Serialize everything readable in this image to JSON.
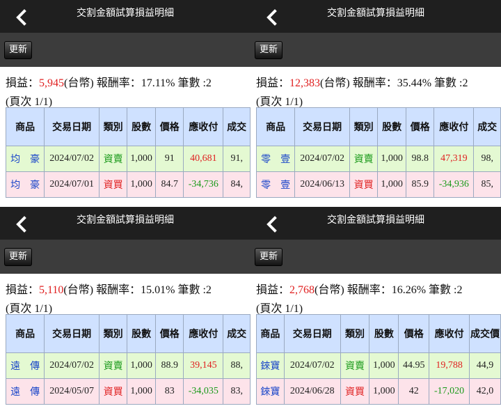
{
  "panels": [
    {
      "title": "交割金額試算損益明細",
      "refresh_label": "更新",
      "summary": {
        "label": "損益：",
        "amount": "5,945",
        "currency": "(台幣)",
        "rate_label": " 報酬率：17.11%",
        "count_label": " 筆數 :2"
      },
      "page_info": "(頁次 1/1)",
      "columns": [
        "商品",
        "交易日期",
        "類別",
        "股數",
        "價格",
        "應收付",
        "成交"
      ],
      "rows": [
        {
          "product": "均　豪",
          "date": "2024/07/02",
          "type": "資賣",
          "shares": "1,000",
          "price": "91",
          "amount": "40,681",
          "deal": "91,"
        },
        {
          "product": "均　豪",
          "date": "2024/07/01",
          "type": "資買",
          "shares": "1,000",
          "price": "84.7",
          "amount": "-34,736",
          "deal": "84,"
        }
      ]
    },
    {
      "title": "交割金額試算損益明細",
      "refresh_label": "更新",
      "summary": {
        "label": "損益：",
        "amount": "12,383",
        "currency": "(台幣)",
        "rate_label": " 報酬率：35.44%",
        "count_label": " 筆數 :2"
      },
      "page_info": "(頁次 1/1)",
      "columns": [
        "商品",
        "交易日期",
        "類別",
        "股數",
        "價格",
        "應收付",
        "成交"
      ],
      "rows": [
        {
          "product": "零　壹",
          "date": "2024/07/02",
          "type": "資賣",
          "shares": "1,000",
          "price": "98.8",
          "amount": "47,319",
          "deal": "98,"
        },
        {
          "product": "零　壹",
          "date": "2024/06/13",
          "type": "資買",
          "shares": "1,000",
          "price": "85.9",
          "amount": "-34,936",
          "deal": "85,"
        }
      ]
    },
    {
      "title": "交割金額試算損益明細",
      "refresh_label": "更新",
      "summary": {
        "label": "損益：",
        "amount": "5,110",
        "currency": "(台幣)",
        "rate_label": " 報酬率：15.01%",
        "count_label": " 筆數 :2"
      },
      "page_info": "(頁次 1/1)",
      "columns": [
        "商品",
        "交易日期",
        "類別",
        "股數",
        "價格",
        "應收付",
        "成交"
      ],
      "rows": [
        {
          "product": "遠　傳",
          "date": "2024/07/02",
          "type": "資賣",
          "shares": "1,000",
          "price": "88.9",
          "amount": "39,145",
          "deal": "88,"
        },
        {
          "product": "遠　傳",
          "date": "2024/05/07",
          "type": "資買",
          "shares": "1,000",
          "price": "83",
          "amount": "-34,035",
          "deal": "83,"
        }
      ]
    },
    {
      "title": "交割金額試算損益明細",
      "refresh_label": "更新",
      "summary": {
        "label": "損益：",
        "amount": "2,768",
        "currency": "(台幣)",
        "rate_label": " 報酬率：16.26%",
        "count_label": " 筆數 :2"
      },
      "page_info": "(頁次 1/1)",
      "columns": [
        "商品",
        "交易日期",
        "類別",
        "股數",
        "價格",
        "應收付",
        "成交價"
      ],
      "rows": [
        {
          "product": "錸寶",
          "date": "2024/07/02",
          "type": "資賣",
          "shares": "1,000",
          "price": "44.95",
          "amount": "19,788",
          "deal": "44,9"
        },
        {
          "product": "錸寶",
          "date": "2024/06/28",
          "type": "資買",
          "shares": "1,000",
          "price": "42",
          "amount": "-17,020",
          "deal": "42,0"
        }
      ]
    }
  ],
  "colors": {
    "header_bg": "#1f1f1f",
    "toolbar_bg": "#3c3c3c",
    "table_header": "#cfe1ff",
    "sell_row": "#e4f9d2",
    "buy_row": "#fde3ea",
    "profit_red": "#e02020",
    "sell_green": "#1a9a1a",
    "product_blue": "#1a46c9"
  },
  "icons": {
    "back": "chevron-left-icon"
  }
}
